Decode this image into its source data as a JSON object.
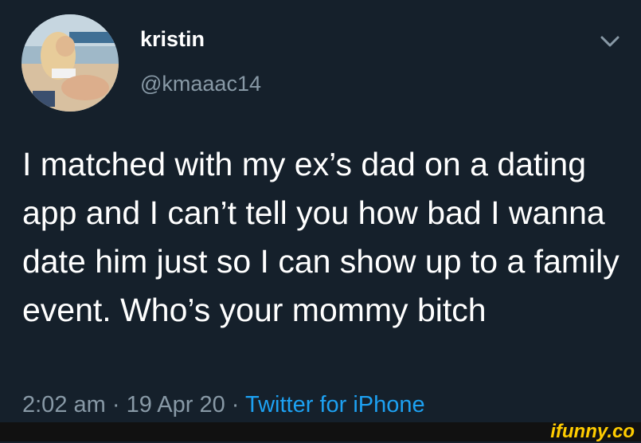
{
  "user": {
    "display_name": "kristin",
    "handle": "@kmaaac14"
  },
  "tweet": {
    "text": "I matched with my ex’s dad on a dating app and I can’t tell you how bad I wanna date him just so I can show up to a family event. Who’s your mommy bitch"
  },
  "meta": {
    "time": "2:02 am",
    "separator": " · ",
    "date": "19 Apr 20",
    "source": "Twitter for iPhone"
  },
  "icons": {
    "avatar": "profile-photo",
    "menu": "chevron-down-icon"
  },
  "colors": {
    "background": "#15202b",
    "text": "#ffffff",
    "secondary": "#8899a6",
    "link": "#1da1f2",
    "watermark": "#ffcc00"
  },
  "watermark": {
    "text": "ifunny.co"
  }
}
